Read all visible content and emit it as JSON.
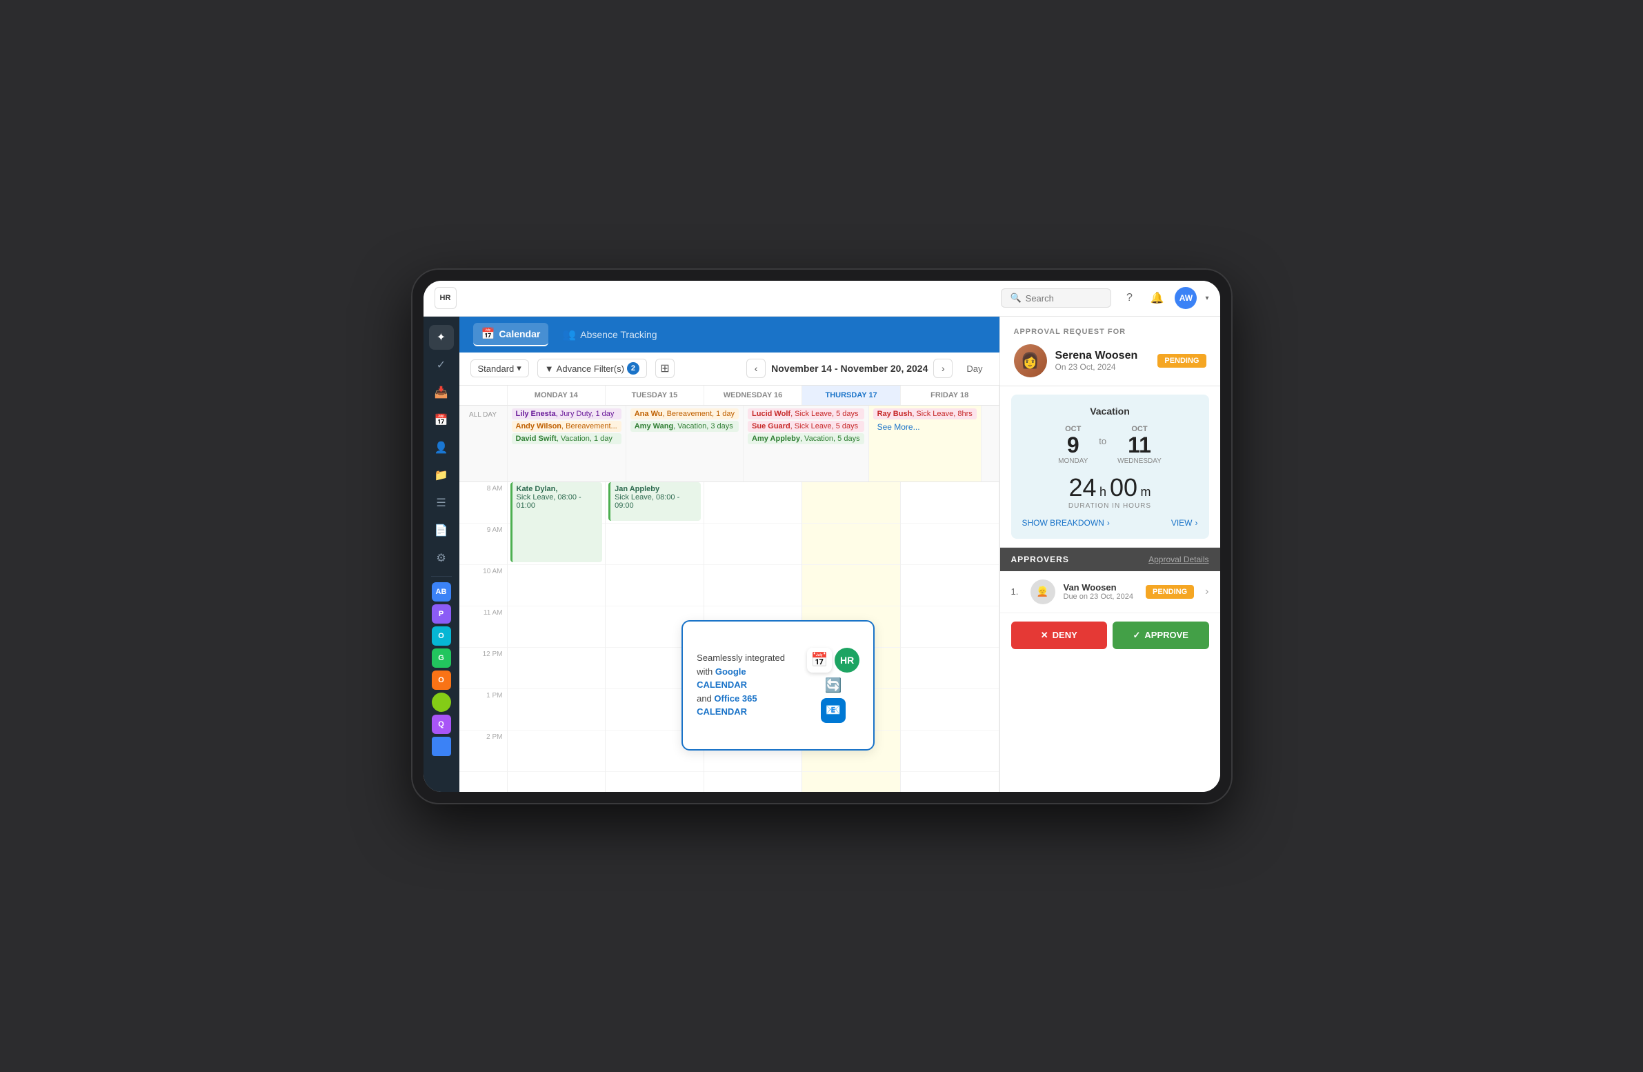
{
  "app": {
    "logo": "HR",
    "title": "HR Calendar"
  },
  "topbar": {
    "search_placeholder": "Search",
    "avatar_initials": "AW",
    "help_icon": "?",
    "bell_icon": "🔔"
  },
  "sidebar": {
    "icons": [
      {
        "name": "home-icon",
        "symbol": "✦",
        "active": true
      },
      {
        "name": "check-icon",
        "symbol": "✓",
        "active": false
      },
      {
        "name": "inbox-icon",
        "symbol": "📥",
        "active": false
      },
      {
        "name": "calendar-icon",
        "symbol": "📅",
        "active": false
      },
      {
        "name": "user-icon",
        "symbol": "👤",
        "active": false
      },
      {
        "name": "folder-icon",
        "symbol": "📁",
        "active": false
      },
      {
        "name": "list-icon",
        "symbol": "☰",
        "active": false
      },
      {
        "name": "doc-icon",
        "symbol": "📄",
        "active": false
      },
      {
        "name": "settings-icon",
        "symbol": "⚙",
        "active": false
      }
    ],
    "colored_icons": [
      {
        "name": "ab-icon",
        "color": "#3b82f6",
        "label": "AB"
      },
      {
        "name": "p-icon",
        "color": "#8b5cf6",
        "label": "P"
      },
      {
        "name": "o-icon",
        "color": "#06b6d4",
        "label": "O"
      },
      {
        "name": "g-icon",
        "color": "#22c55e",
        "label": "G"
      },
      {
        "name": "o2-icon",
        "color": "#f97316",
        "label": "O"
      },
      {
        "name": "gr-icon",
        "color": "#84cc16",
        "label": ""
      },
      {
        "name": "q-icon",
        "color": "#a855f7",
        "label": "Q"
      },
      {
        "name": "b-icon",
        "color": "#3b82f6",
        "label": ""
      }
    ]
  },
  "subheader": {
    "tabs": [
      {
        "id": "calendar",
        "label": "Calendar",
        "icon": "📅",
        "active": true
      },
      {
        "id": "absence",
        "label": "Absence Tracking",
        "icon": "👥",
        "active": false
      }
    ]
  },
  "calendar_controls": {
    "view_label": "Standard",
    "filter_label": "Advance Filter(s)",
    "filter_count": "2",
    "date_range": "November 14 - November 20, 2024",
    "day_label": "Day"
  },
  "calendar": {
    "headers": [
      {
        "day": "MONDAY",
        "date": "14",
        "today": false
      },
      {
        "day": "TUESDAY",
        "date": "15",
        "today": false
      },
      {
        "day": "WEDNESDAY",
        "date": "16",
        "today": false
      },
      {
        "day": "THURSDAY",
        "date": "17",
        "today": true
      },
      {
        "day": "FRIDAY",
        "date": "18",
        "today": false
      }
    ],
    "all_day_label": "ALL DAY",
    "all_day_events": [
      {
        "col": 0,
        "events": [
          {
            "name": "Lily Enesta",
            "type": "Jury Duty, 1 day",
            "class": "jury"
          },
          {
            "name": "Andy Wilson",
            "type": "Bereavement...",
            "class": "bereavement"
          },
          {
            "name": "David Swift",
            "type": "Vacation, 1 day",
            "class": "vacation"
          }
        ]
      },
      {
        "col": 1,
        "events": [
          {
            "name": "Ana Wu",
            "type": "Bereavement, 1 day",
            "class": "bereavement"
          },
          {
            "name": "Amy Wang",
            "type": "Vacation, 3 days",
            "class": "vacation"
          }
        ]
      },
      {
        "col": 2,
        "events": [
          {
            "name": "Lucid Wolf",
            "type": "Sick Leave, 5 days",
            "class": "sick"
          },
          {
            "name": "Sue Guard",
            "type": "Sick Leave, 5 days",
            "class": "sick"
          },
          {
            "name": "Amy Appleby",
            "type": "Vacation, 5 days",
            "class": "vacation"
          }
        ]
      },
      {
        "col": 3,
        "events": []
      },
      {
        "col": 4,
        "events": []
      }
    ],
    "see_more": "See More...",
    "ray_bush_event": "Ray Bush, Sick Leave, 8hrs",
    "time_slots": [
      "8 AM",
      "9 AM",
      "10 AM",
      "11 AM",
      "12 PM",
      "1 PM",
      "2 PM"
    ],
    "time_events": [
      {
        "col": 0,
        "name": "Kate Dylan,",
        "detail": "Sick Leave, 08:00 - 01:00",
        "top": 0,
        "height": 120
      },
      {
        "col": 1,
        "name": "Jan Appleby",
        "detail": "Sick Leave, 08:00 - 09:00",
        "top": 0,
        "height": 60
      }
    ]
  },
  "integration_card": {
    "text_1": "Seamlessly integrated",
    "text_2": "with",
    "google_label": "Google CALENDAR",
    "text_3": "and",
    "office_label": "Office 365 CALENDAR"
  },
  "approval_panel": {
    "title": "APPROVAL REQUEST FOR",
    "requester_name": "Serena Woosen",
    "requester_date": "On 23 Oct, 2024",
    "status": "PENDING",
    "vacation": {
      "title": "Vacation",
      "start_month": "OCT",
      "start_day": "9",
      "start_weekday": "MONDAY",
      "end_month": "OCT",
      "end_day": "11",
      "end_weekday": "WEDNESDAY",
      "to_label": "to",
      "duration_h": "24",
      "duration_m": "00",
      "duration_label": "DURATION IN HOURS",
      "show_breakdown": "SHOW BREAKDOWN",
      "view": "VIEW"
    },
    "approvers": {
      "title": "APPROVERS",
      "details_link": "Approval Details",
      "list": [
        {
          "num": "1.",
          "name": "Van Woosen",
          "due": "Due on 23 Oct, 2024",
          "status": "PENDING"
        }
      ]
    },
    "deny_label": "DENY",
    "approve_label": "APPROVE"
  }
}
